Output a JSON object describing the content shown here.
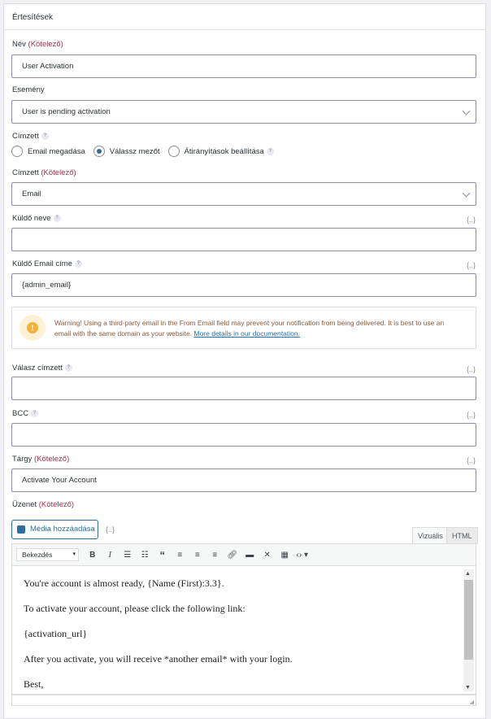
{
  "header": {
    "title": "Értesítések"
  },
  "required": "(Kötelező)",
  "name": {
    "label": "Név",
    "value": "User Activation"
  },
  "event": {
    "label": "Esemény",
    "value": "User is pending activation"
  },
  "recipient": {
    "label": "Címzett",
    "options": [
      "Email megadása",
      "Válassz mezőt",
      "Átirányítások beállítása"
    ],
    "selected": 1
  },
  "recipient_field": {
    "label": "Címzett",
    "value": "Email"
  },
  "sender_name": {
    "label": "Küldő neve",
    "value": "",
    "tag": "{..}"
  },
  "sender_email": {
    "label": "Küldő Email címe",
    "value": "{admin_email}",
    "tag": "{..}"
  },
  "warning": {
    "text": "Warning! Using a third-party email in the From Email field may prevent your notification from being delivered. It is best to use an email with the same domain as your website. ",
    "link": "More details in our documentation."
  },
  "reply_to": {
    "label": "Válasz címzett",
    "value": "",
    "tag": "{..}"
  },
  "bcc": {
    "label": "BCC",
    "value": "",
    "tag": "{..}"
  },
  "subject": {
    "label": "Tárgy",
    "value": "Activate Your Account",
    "tag": "{..}"
  },
  "message": {
    "label": "Üzenet",
    "media_button": "Média hozzáadása",
    "tag": "{..}",
    "tabs": [
      "Vizuális",
      "HTML"
    ],
    "format": "Bekezdés",
    "lines": [
      "You're account is almost ready, {Name (First):3.3}.",
      "To activate your account, please click the following link:",
      "{activation_url}",
      "After you activate, you will receive *another email* with your login.",
      "Best,"
    ]
  }
}
